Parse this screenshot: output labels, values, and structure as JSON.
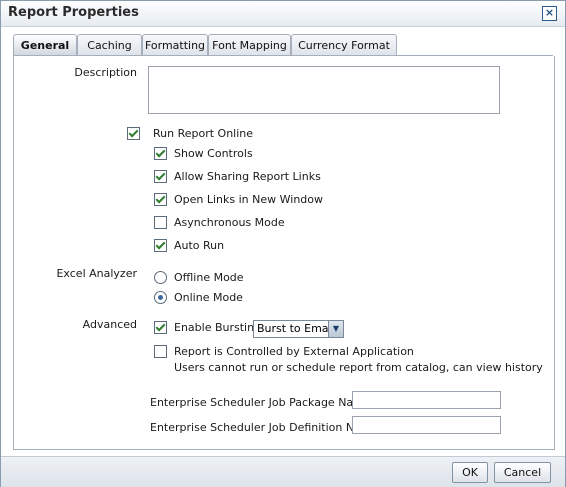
{
  "dialog": {
    "title": "Report Properties"
  },
  "tabs": [
    {
      "label": "General",
      "active": true
    },
    {
      "label": "Caching"
    },
    {
      "label": "Formatting"
    },
    {
      "label": "Font Mapping"
    },
    {
      "label": "Currency Format"
    }
  ],
  "general": {
    "description_label": "Description",
    "description_value": "",
    "run_online": {
      "label": "Run Report Online",
      "checked": true
    },
    "sub_options": [
      {
        "label": "Show Controls",
        "checked": true
      },
      {
        "label": "Allow Sharing Report Links",
        "checked": true
      },
      {
        "label": "Open Links in New Window",
        "checked": true
      },
      {
        "label": "Asynchronous Mode",
        "checked": false
      },
      {
        "label": "Auto Run",
        "checked": true
      }
    ],
    "excel_analyzer": {
      "label": "Excel Analyzer",
      "options": [
        {
          "label": "Offline Mode",
          "selected": false
        },
        {
          "label": "Online Mode",
          "selected": true
        }
      ]
    },
    "advanced": {
      "label": "Advanced",
      "enable_bursting": {
        "label": "Enable Bursting",
        "checked": true
      },
      "burst_select": "Burst to Email",
      "external_app": {
        "label": "Report is Controlled by External Application",
        "checked": false
      },
      "external_note": "Users cannot run or schedule report from catalog, can view history"
    },
    "ess_package": {
      "label": "Enterprise Scheduler Job Package Name",
      "value": ""
    },
    "ess_definition": {
      "label": "Enterprise Scheduler Job Definition Name",
      "value": ""
    }
  },
  "footer": {
    "ok": "OK",
    "cancel": "Cancel"
  }
}
